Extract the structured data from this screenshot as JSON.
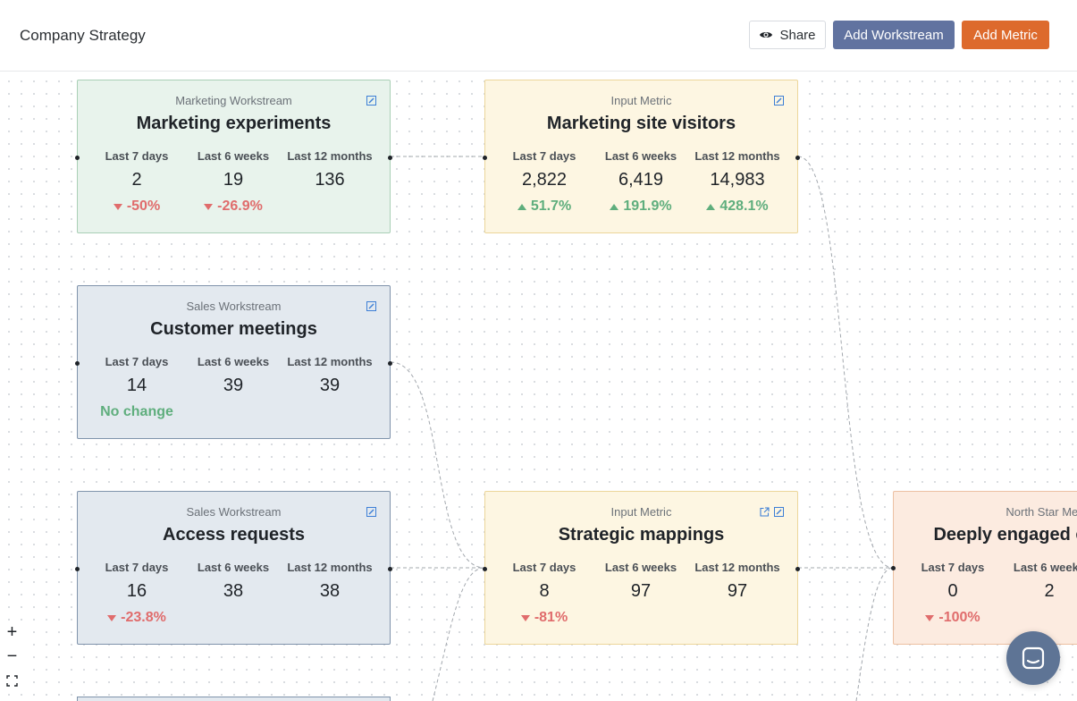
{
  "header": {
    "title": "Company Strategy",
    "share_label": "Share",
    "add_workstream_label": "Add Workstream",
    "add_metric_label": "Add Metric"
  },
  "periods": [
    "Last 7 days",
    "Last 6 weeks",
    "Last 12 months"
  ],
  "cards": {
    "marketing_experiments": {
      "type": "Marketing Workstream",
      "name": "Marketing experiments",
      "values": [
        "2",
        "19",
        "136"
      ],
      "changes": [
        {
          "text": "-50%",
          "dir": "down"
        },
        {
          "text": "-26.9%",
          "dir": "down"
        },
        {
          "text": "",
          "dir": ""
        }
      ]
    },
    "marketing_site_visitors": {
      "type": "Input Metric",
      "name": "Marketing site visitors",
      "values": [
        "2,822",
        "6,419",
        "14,983"
      ],
      "changes": [
        {
          "text": "51.7%",
          "dir": "up"
        },
        {
          "text": "191.9%",
          "dir": "up"
        },
        {
          "text": "428.1%",
          "dir": "up"
        }
      ]
    },
    "customer_meetings": {
      "type": "Sales Workstream",
      "name": "Customer meetings",
      "values": [
        "14",
        "39",
        "39"
      ],
      "changes": [
        {
          "text": "No change",
          "dir": "neutral"
        },
        {
          "text": "",
          "dir": ""
        },
        {
          "text": "",
          "dir": ""
        }
      ]
    },
    "access_requests": {
      "type": "Sales Workstream",
      "name": "Access requests",
      "values": [
        "16",
        "38",
        "38"
      ],
      "changes": [
        {
          "text": "-23.8%",
          "dir": "down"
        },
        {
          "text": "",
          "dir": ""
        },
        {
          "text": "",
          "dir": ""
        }
      ]
    },
    "strategic_mappings": {
      "type": "Input Metric",
      "name": "Strategic mappings",
      "values": [
        "8",
        "97",
        "97"
      ],
      "changes": [
        {
          "text": "-81%",
          "dir": "down"
        },
        {
          "text": "",
          "dir": ""
        },
        {
          "text": "",
          "dir": ""
        }
      ]
    },
    "deeply_engaged": {
      "type": "North Star Metric",
      "name": "Deeply engaged customers",
      "values": [
        "0",
        "2"
      ],
      "changes": [
        {
          "text": "-100%",
          "dir": "down"
        },
        {
          "text": "",
          "dir": ""
        }
      ]
    }
  },
  "zoom_controls": {
    "zoom_in": "+",
    "zoom_out": "−",
    "fit": "⛶"
  },
  "icons": {
    "share": "eye-icon",
    "edit": "edit-icon",
    "open": "external-link-icon",
    "chat": "chat-icon"
  },
  "colors": {
    "marketing_workstream_bg": "#e8f3ec",
    "sales_workstream_bg": "#e3e9ef",
    "input_metric_bg": "#fdf6e2",
    "north_star_bg": "#fcebe0",
    "add_workstream_button": "#6173a0",
    "add_metric_button": "#dd6a2c",
    "negative": "#e06c6c",
    "positive": "#5fae7d"
  }
}
